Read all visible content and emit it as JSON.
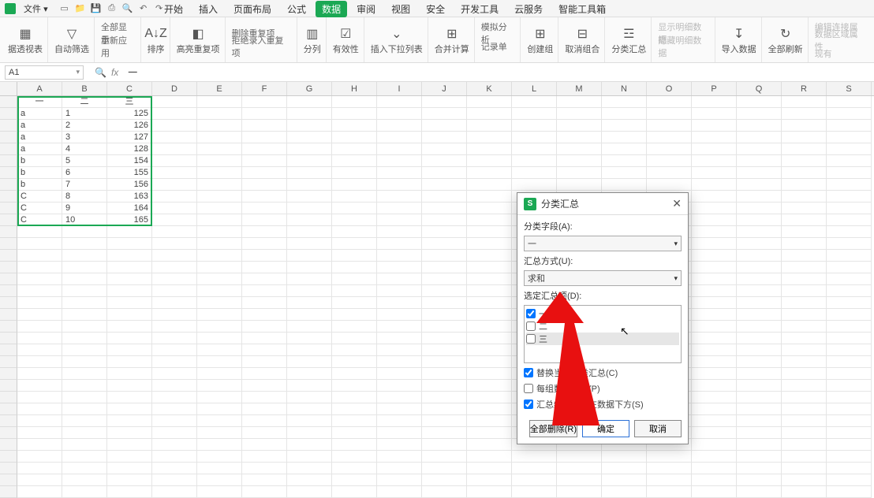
{
  "filebar": {
    "label": "文件",
    "dd": "▾"
  },
  "menu": {
    "tabs": [
      "开始",
      "插入",
      "页面布局",
      "公式",
      "数据",
      "审阅",
      "视图",
      "安全",
      "开发工具",
      "云服务",
      "智能工具箱"
    ],
    "active": 4
  },
  "ribbon": {
    "items": [
      {
        "label": "据透视表",
        "icon": "▦"
      },
      {
        "label": "自动筛选",
        "icon": "▽"
      },
      {
        "label": "全部显示",
        "sub": true,
        "row2": "重新应用"
      },
      {
        "label": "排序",
        "icon": "A↓Z"
      },
      {
        "label": "高亮重复项",
        "icon": "◧"
      },
      {
        "label": "删除重复项",
        "sub2": true,
        "row2": "拒绝录入重复项"
      },
      {
        "label": "分列",
        "icon": "▥"
      },
      {
        "label": "有效性",
        "icon": "☑"
      },
      {
        "label": "插入下拉列表",
        "icon": "⌄"
      },
      {
        "label": "合并计算",
        "icon": "⊞"
      },
      {
        "label": "模拟分析",
        "sub2": true,
        "row2": "记录单"
      },
      {
        "label": "创建组",
        "icon": "⊞"
      },
      {
        "label": "取消组合",
        "icon": "⊟"
      },
      {
        "label": "分类汇总",
        "icon": "☲"
      },
      {
        "label": "显示明细数据",
        "sub2": true,
        "row2": "隐藏明细数据",
        "dim": true
      },
      {
        "label": "导入数据",
        "icon": "↧"
      },
      {
        "label": "全部刷新",
        "icon": "↻"
      },
      {
        "label": "编辑连接属",
        "sub2": true,
        "row2": "数据区域属性",
        "row3": "现有",
        "dim": true
      }
    ]
  },
  "namebox": "A1",
  "fxvalue": "一",
  "columns": [
    "A",
    "B",
    "C",
    "D",
    "E",
    "F",
    "G",
    "H",
    "I",
    "J",
    "K",
    "L",
    "M",
    "N",
    "O",
    "P",
    "Q",
    "R",
    "S"
  ],
  "sheet": {
    "headers": [
      "一",
      "二",
      "三"
    ],
    "rows": [
      [
        "a",
        "1",
        "125"
      ],
      [
        "a",
        "2",
        "126"
      ],
      [
        "a",
        "3",
        "127"
      ],
      [
        "a",
        "4",
        "128"
      ],
      [
        "b",
        "5",
        "154"
      ],
      [
        "b",
        "6",
        "155"
      ],
      [
        "b",
        "7",
        "156"
      ],
      [
        "C",
        "8",
        "163"
      ],
      [
        "C",
        "9",
        "164"
      ],
      [
        "C",
        "10",
        "165"
      ]
    ]
  },
  "dialog": {
    "title": "分类汇总",
    "field_label": "分类字段(A):",
    "field_value": "一",
    "method_label": "汇总方式(U):",
    "method_value": "求和",
    "items_label": "选定汇总项(D):",
    "items": [
      {
        "label": "一",
        "checked": true
      },
      {
        "label": "二",
        "checked": false
      },
      {
        "label": "三",
        "checked": false
      }
    ],
    "opt_replace": "替换当前分类汇总(C)",
    "opt_page": "每组数据分页(P)",
    "opt_below": "汇总结果显示在数据下方(S)",
    "btn_clear": "全部删除(R)",
    "btn_ok": "确定",
    "btn_cancel": "取消"
  }
}
